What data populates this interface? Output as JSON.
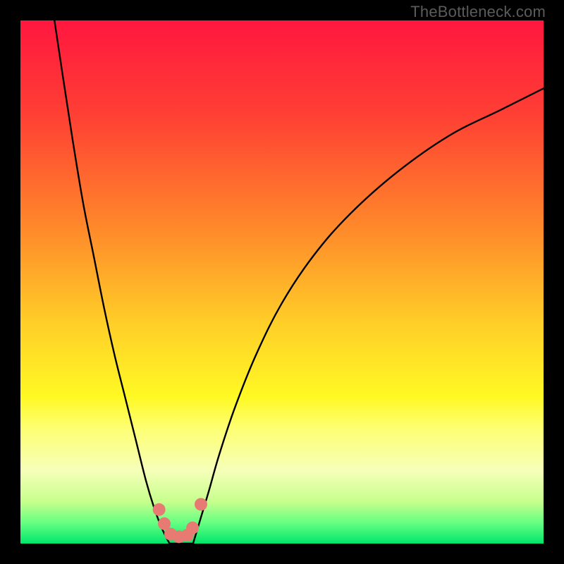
{
  "watermark": "TheBottleneck.com",
  "chart_data": {
    "type": "line",
    "title": "",
    "xlabel": "",
    "ylabel": "",
    "xlim": [
      0,
      100
    ],
    "ylim": [
      0,
      100
    ],
    "gradient_stops": [
      {
        "offset": 0,
        "color": "#ff173f"
      },
      {
        "offset": 18,
        "color": "#ff3f34"
      },
      {
        "offset": 40,
        "color": "#ff8a2a"
      },
      {
        "offset": 58,
        "color": "#ffcf28"
      },
      {
        "offset": 72,
        "color": "#fff924"
      },
      {
        "offset": 78,
        "color": "#fdff73"
      },
      {
        "offset": 86,
        "color": "#f6ffb8"
      },
      {
        "offset": 92,
        "color": "#c7ff8d"
      },
      {
        "offset": 96,
        "color": "#66ff82"
      },
      {
        "offset": 100,
        "color": "#00e66b"
      }
    ],
    "series": [
      {
        "name": "left-curve",
        "x": [
          6.5,
          8,
          10,
          12,
          14,
          16,
          18,
          20,
          22,
          24,
          25.5,
          27,
          28.5
        ],
        "values": [
          100,
          90,
          77,
          65,
          55,
          45,
          36,
          28,
          20,
          12,
          7,
          3,
          0
        ]
      },
      {
        "name": "right-curve",
        "x": [
          33,
          34.5,
          36,
          38,
          41,
          45,
          50,
          56,
          63,
          72,
          82,
          92,
          100
        ],
        "values": [
          0,
          5,
          10,
          17,
          26,
          36,
          46,
          55,
          63,
          71,
          78,
          83,
          87
        ]
      },
      {
        "name": "valley-floor",
        "x": [
          28.5,
          30,
          31.5,
          33
        ],
        "values": [
          0,
          0,
          0,
          0
        ]
      }
    ],
    "highlight_dots": {
      "name": "valley-dots",
      "color": "#e77a72",
      "radius": 9,
      "points": [
        {
          "x": 26.5,
          "y": 6.5
        },
        {
          "x": 27.5,
          "y": 3.8
        },
        {
          "x": 28.7,
          "y": 1.8
        },
        {
          "x": 30.3,
          "y": 1.3
        },
        {
          "x": 31.9,
          "y": 1.6
        },
        {
          "x": 32.9,
          "y": 3.0
        },
        {
          "x": 34.5,
          "y": 7.5
        }
      ]
    }
  }
}
